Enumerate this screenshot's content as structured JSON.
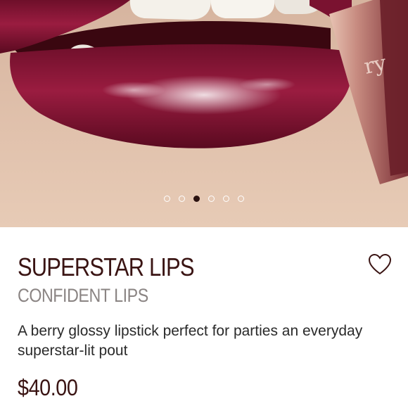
{
  "product": {
    "image_alt": "Model wearing berry glossy lipstick",
    "brand_watermark": "ry",
    "carousel": {
      "total": 6,
      "active_index": 2
    },
    "title": "SUPERSTAR LIPS",
    "subtitle": "CONFIDENT LIPS",
    "description": "A berry glossy lipstick perfect for parties an everyday superstar-lit pout",
    "price": "$40.00"
  },
  "icons": {
    "wishlist": "heart-outline-icon"
  },
  "colors": {
    "accent": "#3a1413",
    "lip": "#8c1235",
    "subtitle": "#8a8483"
  }
}
